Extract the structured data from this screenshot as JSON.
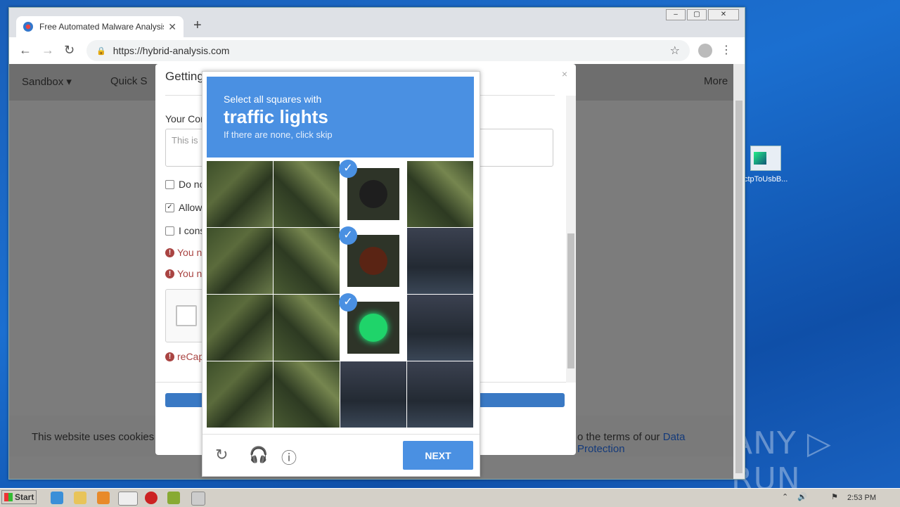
{
  "browser": {
    "tab_title": "Free Automated Malware Analysis Service",
    "url": "https://hybrid-analysis.com",
    "new_tab": "+"
  },
  "site": {
    "nav": [
      "Sandbox ▾",
      "Quick S",
      "More"
    ],
    "cookie_left": "This website uses cookies to",
    "cookie_right": "o the terms of our",
    "cookie_link": "Data Protection"
  },
  "modal": {
    "title": "Getting Things Ready",
    "label": "Your Cor",
    "textarea_placeholder": "This is",
    "checkbox1": "Do no",
    "checkbox2": "Allow",
    "checkbox3": "I cons",
    "error1": "You n",
    "error2": "You n",
    "error3": "reCap"
  },
  "captcha": {
    "line1": "Select all squares with",
    "line2": "traffic lights",
    "line3": "If there are none, click skip",
    "next": "NEXT",
    "tiles": [
      {
        "kind": "tree",
        "selected": false
      },
      {
        "kind": "tree",
        "selected": false
      },
      {
        "kind": "light-off",
        "selected": true
      },
      {
        "kind": "tree",
        "selected": false
      },
      {
        "kind": "tree",
        "selected": false
      },
      {
        "kind": "tree",
        "selected": false
      },
      {
        "kind": "light-red",
        "selected": true
      },
      {
        "kind": "pole",
        "selected": false
      },
      {
        "kind": "tree",
        "selected": false
      },
      {
        "kind": "tree",
        "selected": false
      },
      {
        "kind": "light-green",
        "selected": true
      },
      {
        "kind": "pole",
        "selected": false
      },
      {
        "kind": "tree",
        "selected": false
      },
      {
        "kind": "tree",
        "selected": false
      },
      {
        "kind": "pole",
        "selected": false
      },
      {
        "kind": "pole",
        "selected": false
      }
    ]
  },
  "desktop": {
    "icon_label": "ctpToUsbB...",
    "watermark": "ANY ▷ RUN"
  },
  "taskbar": {
    "start": "Start",
    "time": "2:53 PM"
  }
}
